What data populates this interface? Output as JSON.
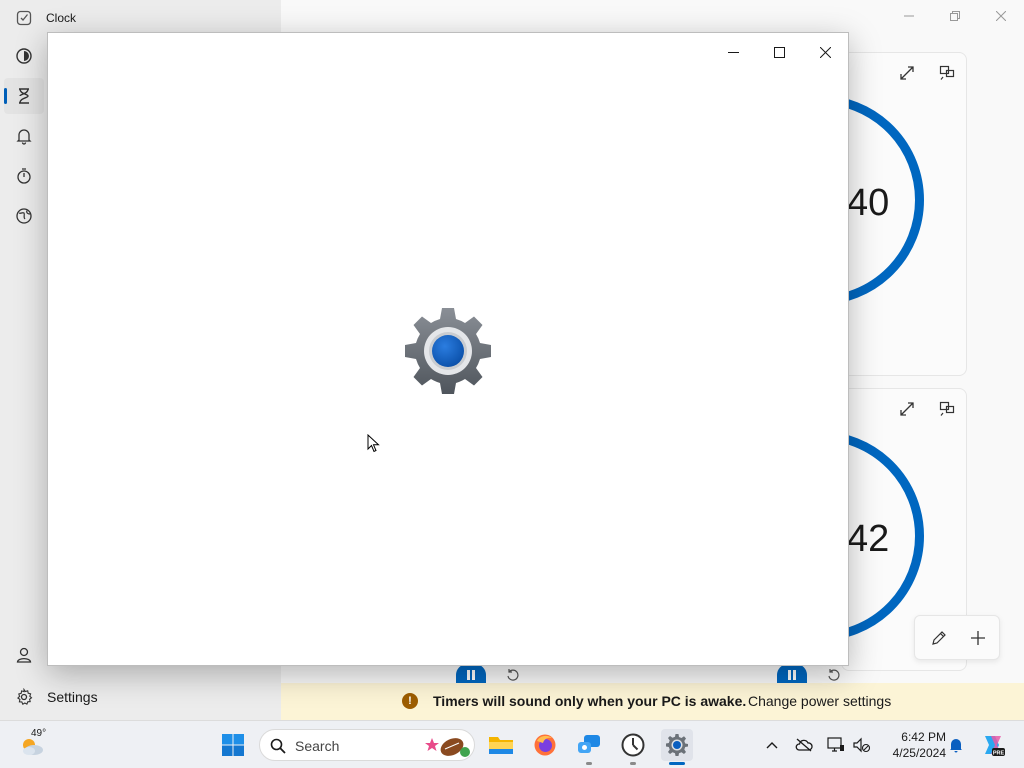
{
  "clock_app": {
    "title": "Clock",
    "sidebar": {
      "items": [
        {
          "name": "focus-sessions",
          "icon": "focus-icon",
          "active": false
        },
        {
          "name": "timer",
          "icon": "hourglass-icon",
          "active": true
        },
        {
          "name": "alarm",
          "icon": "bell-icon",
          "active": false
        },
        {
          "name": "stopwatch",
          "icon": "stopwatch-icon",
          "active": false
        },
        {
          "name": "world-clock",
          "icon": "globe-icon",
          "active": false
        }
      ],
      "settings_label": "Settings"
    },
    "timers": [
      {
        "display": "40",
        "progress_color": "#0067c0"
      },
      {
        "display": "42",
        "progress_color": "#0067c0"
      }
    ],
    "info_bar": {
      "message": "Timers will sound only when your PC is awake.",
      "link": "Change power settings",
      "icon": "!"
    }
  },
  "settings_window": {
    "splash_icon": "settings-gear-icon"
  },
  "taskbar": {
    "weather_temp": "49°",
    "search_placeholder": "Search",
    "time": "6:42 PM",
    "date": "4/25/2024",
    "apps": [
      "start",
      "search",
      "file-explorer",
      "firefox",
      "teams",
      "clock",
      "settings"
    ]
  },
  "colors": {
    "accent": "#0067c0",
    "info_bar_bg": "#fcf4d6",
    "warning": "#9d5d00"
  }
}
